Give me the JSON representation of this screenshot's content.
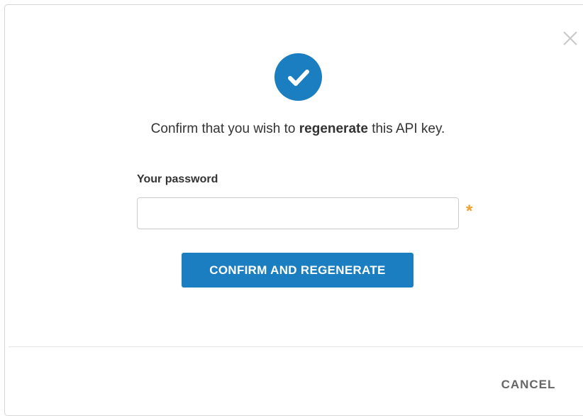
{
  "dialog": {
    "close_icon": "close-icon",
    "status_icon": "check-circle-icon",
    "message": {
      "before": "Confirm that you wish to ",
      "bold": "regenerate",
      "after": " this API key."
    },
    "password": {
      "label": "Your password",
      "value": "",
      "placeholder": "",
      "required_marker": "*"
    },
    "confirm_button_label": "CONFIRM AND REGENERATE",
    "cancel_button_label": "CANCEL"
  },
  "colors": {
    "accent": "#1a7ec1",
    "required": "#f0a22f",
    "text": "#333333",
    "muted": "#666666"
  }
}
